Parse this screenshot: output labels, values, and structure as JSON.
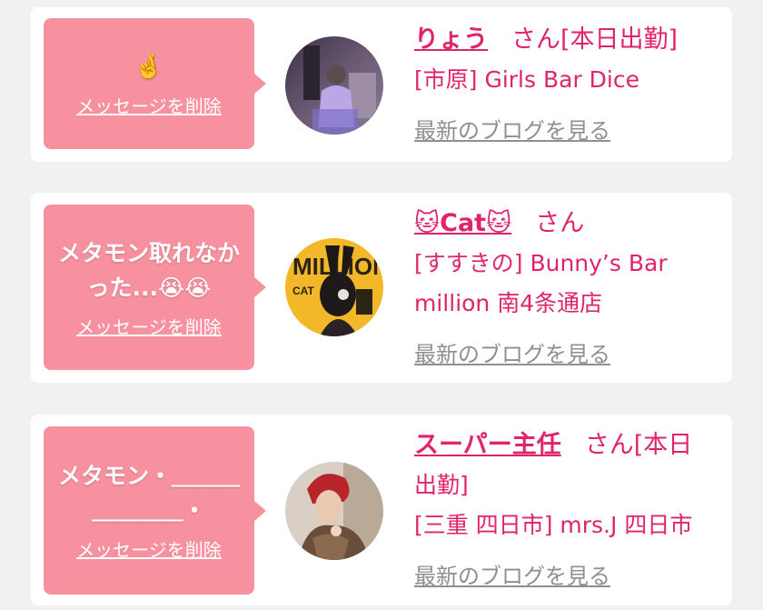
{
  "colors": {
    "accent": "#e0246b",
    "bubble": "#f7919f",
    "link_gray": "#8f8f8f"
  },
  "cards": [
    {
      "message": "🤞",
      "delete_label": "メッセージを削除",
      "name": "りょう",
      "san": "さん",
      "status": "[本日出勤]",
      "location": "[市原] Girls Bar Dice",
      "blog_label": "最新のブログを見る"
    },
    {
      "message": "メタモン取れなかった...😭😭",
      "delete_label": "メッセージを削除",
      "name": "🐱Cat🐱",
      "san": "さん",
      "location_line1": "[すすきの] Bunny’s Bar",
      "location_line2": "million 南4条通店",
      "blog_label": "最新のブログを見る"
    },
    {
      "message": "メタモン・＿＿＿＿＿＿＿・",
      "delete_label": "メッセージを削除",
      "name": "スーパー主任",
      "san": "さん",
      "status_part1": "[本日",
      "status_part2": "出勤]",
      "location": "[三重 四日市] mrs.J 四日市",
      "blog_label": "最新のブログを見る"
    }
  ]
}
